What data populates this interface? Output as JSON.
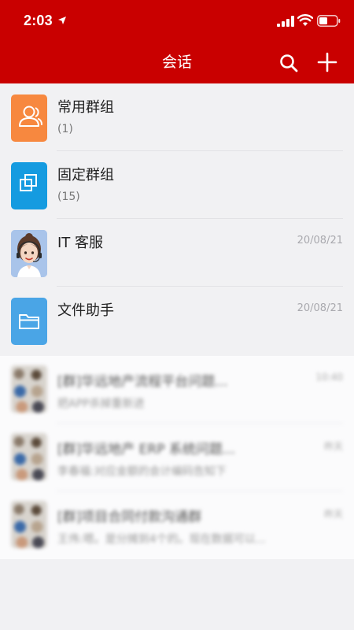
{
  "status_bar": {
    "time": "2:03"
  },
  "header": {
    "title": "会话"
  },
  "conversations": [
    {
      "title": "常用群组",
      "subtitle": "(1)",
      "time": "",
      "icon": "group-icon",
      "color": "#f7883f"
    },
    {
      "title": "固定群组",
      "subtitle": "(15)",
      "time": "",
      "icon": "copy-squares-icon",
      "color": "#159be0"
    },
    {
      "title": "IT 客服",
      "subtitle": "",
      "time": "20/08/21",
      "icon": "support-agent-avatar"
    },
    {
      "title": "文件助手",
      "subtitle": "",
      "time": "20/08/21",
      "icon": "folder-icon",
      "color": "#4aa5e6"
    }
  ],
  "blurred_conversations": [
    {
      "title": "[群]华远地产流程平台问题...",
      "subtitle": "把APP杀掉重新进",
      "time": "10:40"
    },
    {
      "title": "[群]华远地产 ERP 系统问题...",
      "subtitle": "李春福:对应金额的会计编码告知下",
      "time": "昨天"
    },
    {
      "title": "[群]项目合同付款沟通群",
      "subtitle": "王伟:嗯。是分摊到4个的。现在数据可以...",
      "time": "昨天"
    }
  ],
  "colors": {
    "brand_red": "#c90000",
    "background": "#f1f1f3"
  }
}
